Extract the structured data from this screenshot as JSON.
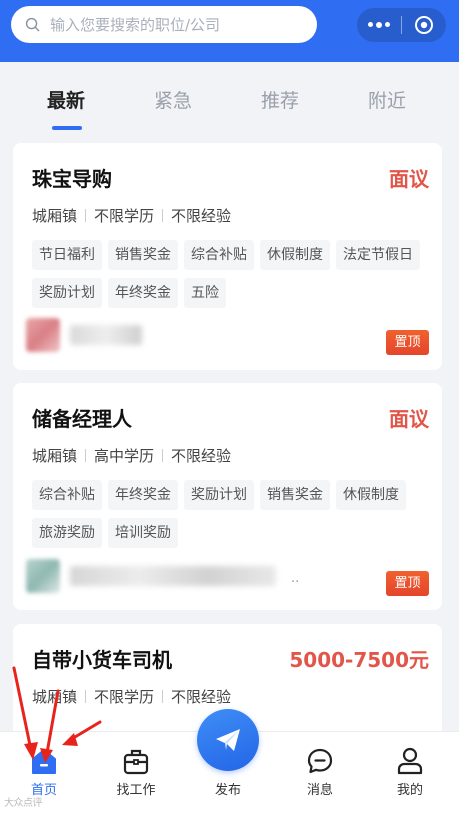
{
  "search": {
    "placeholder": "输入您要搜索的职位/公司"
  },
  "tabs": [
    {
      "label": "最新",
      "active": true
    },
    {
      "label": "紧急",
      "active": false
    },
    {
      "label": "推荐",
      "active": false
    },
    {
      "label": "附近",
      "active": false
    }
  ],
  "jobs": [
    {
      "title": "珠宝导购",
      "salary": "面议",
      "location": "城厢镇",
      "education": "不限学历",
      "experience": "不限经验",
      "tags": [
        "节日福利",
        "销售奖金",
        "综合补贴",
        "休假制度",
        "法定节假日",
        "奖励计划",
        "年终奖金",
        "五险"
      ],
      "badge": "置顶"
    },
    {
      "title": "储备经理人",
      "salary": "面议",
      "location": "城厢镇",
      "education": "高中学历",
      "experience": "不限经验",
      "tags": [
        "综合补贴",
        "年终奖金",
        "奖励计划",
        "销售奖金",
        "休假制度",
        "旅游奖励",
        "培训奖励"
      ],
      "badge": "置顶"
    },
    {
      "title": "自带小货车司机",
      "salary": "5000-7500元",
      "location": "城厢镇",
      "education": "不限学历",
      "experience": "不限经验"
    }
  ],
  "card2_ellipsis": "..",
  "nav": [
    {
      "label": "首页",
      "icon": "home-icon",
      "active": true
    },
    {
      "label": "找工作",
      "icon": "briefcase-icon",
      "active": false
    },
    {
      "label": "发布",
      "icon": "paper-plane-icon",
      "active": false
    },
    {
      "label": "消息",
      "icon": "chat-bubble-icon",
      "active": false
    },
    {
      "label": "我的",
      "icon": "user-icon",
      "active": false
    }
  ],
  "watermark": "大众点评",
  "colors": {
    "primary": "#2f6ef2",
    "salary": "#e2564a",
    "pin": "#e4452b",
    "annotation_arrow": "#e8231b"
  }
}
